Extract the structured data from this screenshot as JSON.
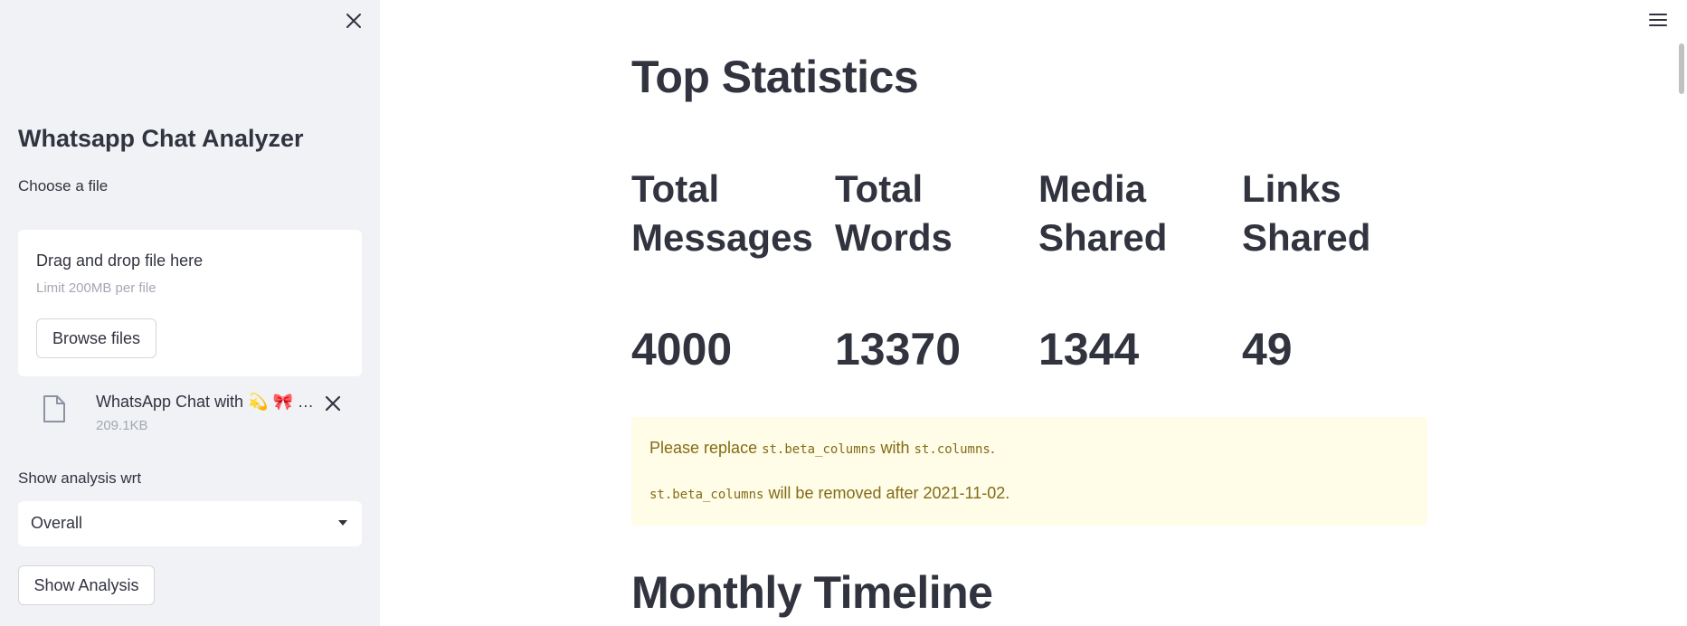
{
  "sidebar": {
    "title": "Whatsapp Chat Analyzer",
    "file_label": "Choose a file",
    "uploader": {
      "drag_text": "Drag and drop file here",
      "limit_text": "Limit 200MB per file",
      "browse_label": "Browse files"
    },
    "uploaded_file": {
      "name": "WhatsApp Chat with 💫 🎀 …",
      "size": "209.1KB"
    },
    "analysis_label": "Show analysis wrt",
    "select_value": "Overall",
    "show_button": "Show Analysis"
  },
  "main": {
    "top_heading": "Top Statistics",
    "stats": [
      {
        "label_line1": "Total",
        "label_line2": "Messages",
        "value": "4000"
      },
      {
        "label_line1": "Total",
        "label_line2": "Words",
        "value": "13370"
      },
      {
        "label_line1": "Media",
        "label_line2": "Shared",
        "value": "1344"
      },
      {
        "label_line1": "Links",
        "label_line2": "Shared",
        "value": "49"
      }
    ],
    "warning": {
      "l1_pre": "Please replace ",
      "l1_code1": "st.beta_columns",
      "l1_mid": " with ",
      "l1_code2": "st.columns",
      "l1_post": ".",
      "l2_code": "st.beta_columns",
      "l2_post": " will be removed after 2021-11-02."
    },
    "timeline_heading": "Monthly Timeline"
  },
  "icons": {
    "close": "close-icon",
    "file": "file-icon",
    "delete": "close-icon",
    "menu": "hamburger-menu-icon",
    "caret": "chevron-down-icon"
  },
  "colors": {
    "sidebar_bg": "#f0f2f6",
    "text": "#31333f",
    "muted": "#a3a8b4",
    "warning_bg": "#fffce7",
    "warning_text": "#826c17"
  }
}
